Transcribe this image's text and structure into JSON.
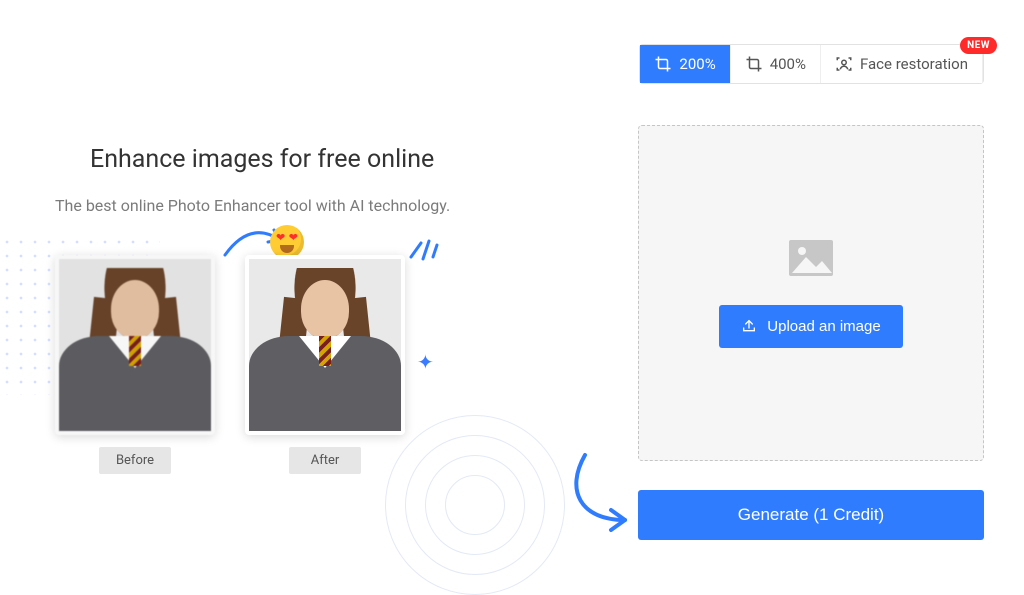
{
  "hero": {
    "title": "Enhance images for free online",
    "subtitle": "The best online Photo Enhancer tool with AI technology."
  },
  "compare": {
    "before_label": "Before",
    "after_label": "After"
  },
  "tabs": {
    "scale200": "200%",
    "scale400": "400%",
    "face_restore": "Face restoration",
    "new_badge": "NEW"
  },
  "upload": {
    "button": "Upload an image"
  },
  "generate": {
    "label": "Generate (1 Credit)"
  }
}
